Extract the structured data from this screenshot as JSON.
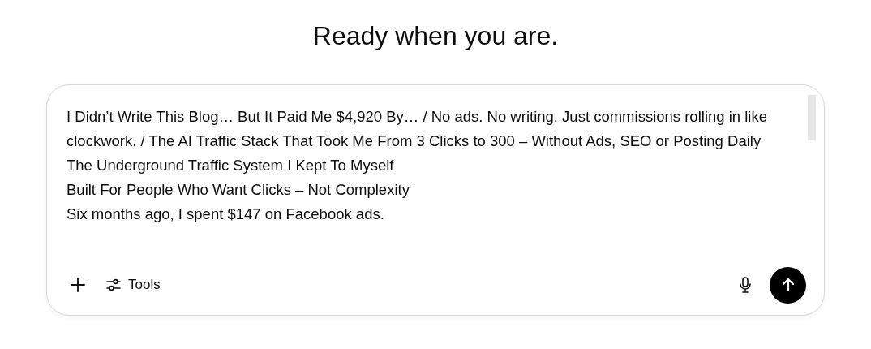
{
  "heading": "Ready when you are.",
  "composer": {
    "lines": [
      "I Didn’t Write This Blog… But It Paid Me $4,920 By… / No ads. No writing. Just commissions rolling in like clockwork. / The AI Traffic Stack That Took Me From 3 Clicks to 300 – Without Ads, SEO or Posting Daily",
      "The Underground Traffic System I Kept To Myself",
      "Built For People Who Want Clicks – Not Complexity",
      "Six months ago, I spent $147 on Facebook ads."
    ],
    "tools_label": "Tools"
  }
}
